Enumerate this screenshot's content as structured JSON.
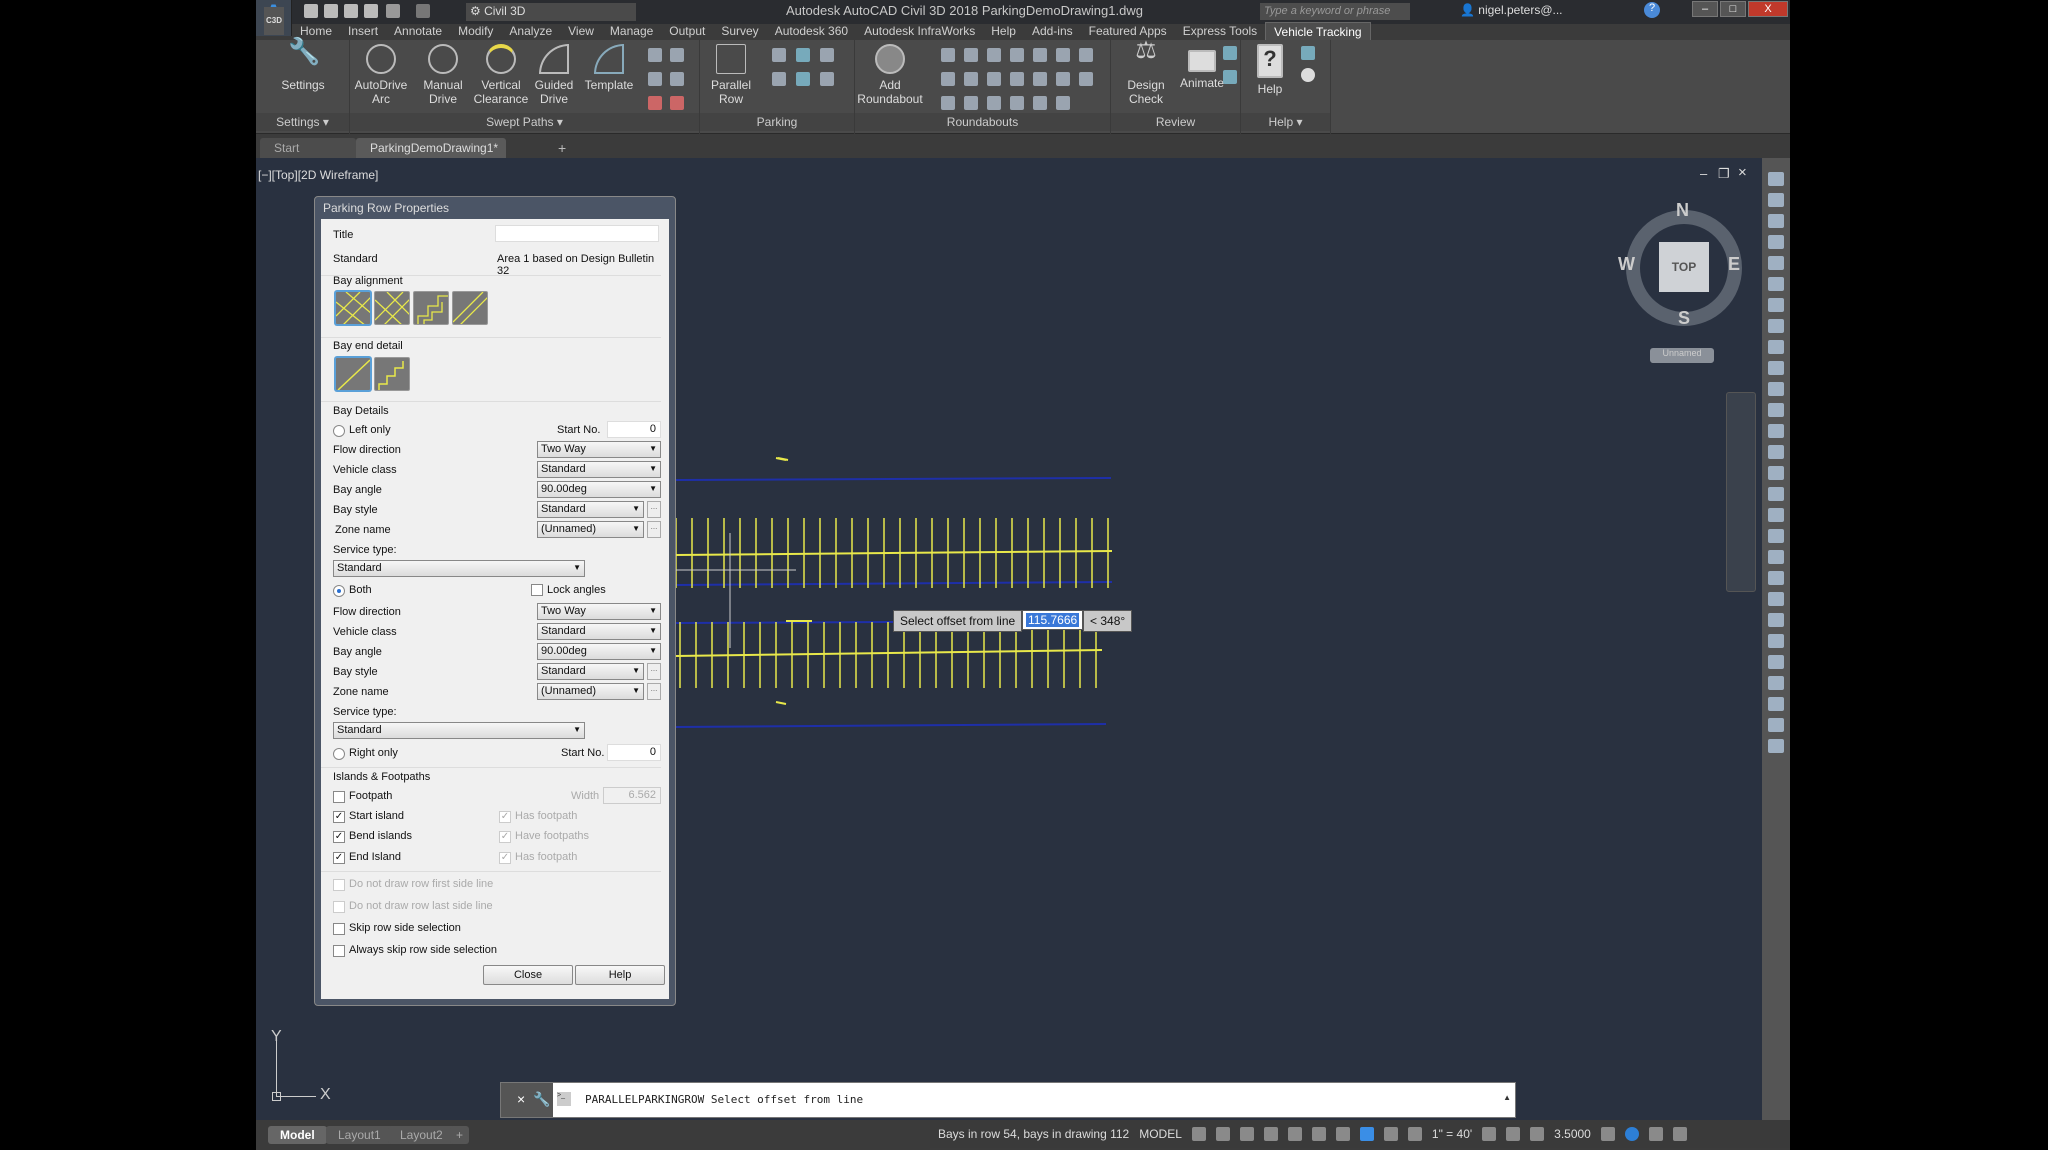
{
  "title_bar": {
    "app_button": "A",
    "app_badge": "C3D",
    "workspace": "Civil 3D",
    "title": "Autodesk AutoCAD Civil 3D 2018    ParkingDemoDrawing1.dwg",
    "search_placeholder": "Type a keyword or phrase",
    "user": "nigel.peters@...",
    "minimize": "–",
    "maximize": "□",
    "close": "X"
  },
  "menu_tabs": [
    "Home",
    "Insert",
    "Annotate",
    "Modify",
    "Analyze",
    "View",
    "Manage",
    "Output",
    "Survey",
    "Autodesk 360",
    "Autodesk InfraWorks",
    "Help",
    "Add-ins",
    "Featured Apps",
    "Express Tools",
    "Vehicle Tracking"
  ],
  "ribbon": {
    "panels": [
      "Settings ▾",
      "Swept Paths ▾",
      "Parking",
      "Roundabouts",
      "Review",
      "Help ▾"
    ],
    "buttons": {
      "settings": "Settings",
      "autodrive": "AutoDrive Arc",
      "manual": "Manual Drive",
      "vertical": "Vertical Clearance",
      "guided": "Guided Drive",
      "template": "Template",
      "parallel": "Parallel Row",
      "roundabout": "Add Roundabout",
      "design_check": "Design Check",
      "animate": "Animate",
      "help": "Help"
    }
  },
  "doc_tabs": {
    "start": "Start",
    "active": "ParkingDemoDrawing1*",
    "close": "×",
    "new": "+"
  },
  "viewport": {
    "label": "[−][Top][2D Wireframe]",
    "viewcube": {
      "n": "N",
      "s": "S",
      "e": "E",
      "w": "W",
      "face": "TOP",
      "ucs": "Unnamed"
    },
    "axis_x": "X",
    "axis_y": "Y",
    "controls": {
      "min": "–",
      "restore": "❐",
      "close": "×"
    }
  },
  "dialog": {
    "title": "Parking Row Properties",
    "title_label": "Title",
    "title_value": "",
    "standard_label": "Standard",
    "standard_value": "Area 1 based on Design Bulletin 32",
    "bay_alignment": "Bay alignment",
    "bay_end_detail": "Bay end detail",
    "bay_details": "Bay Details",
    "left_only": "Left only",
    "start_no_label": "Start No.",
    "left_start_no": "0",
    "left": {
      "flow_label": "Flow direction",
      "flow": "Two Way",
      "vehicle_label": "Vehicle class",
      "vehicle": "Standard",
      "angle_label": "Bay angle",
      "angle": "90.00deg",
      "style_label": "Bay style",
      "style": "Standard",
      "zone_label": "Zone name",
      "zone": "(Unnamed)",
      "service_label": "Service type:",
      "service": "Standard"
    },
    "both": "Both",
    "lock_angles": "Lock angles",
    "right": {
      "flow_label": "Flow direction",
      "flow": "Two Way",
      "vehicle_label": "Vehicle class",
      "vehicle": "Standard",
      "angle_label": "Bay angle",
      "angle": "90.00deg",
      "style_label": "Bay style",
      "style": "Standard",
      "zone_label": "Zone name",
      "zone": "(Unnamed)",
      "service_label": "Service type:",
      "service": "Standard"
    },
    "right_only": "Right only",
    "right_start_no": "0",
    "islands": "Islands & Footpaths",
    "footpath": "Footpath",
    "width_label": "Width",
    "width_value": "6.562",
    "start_island": "Start island",
    "bend_islands": "Bend islands",
    "end_island": "End Island",
    "has_footpath": "Has footpath",
    "have_footpaths": "Have footpaths",
    "has_footpath2": "Has footpath",
    "no_first": "Do not draw row first side line",
    "no_last": "Do not draw row last side line",
    "skip": "Skip row side selection",
    "always_skip": "Always skip row side selection",
    "ellipsis": "...",
    "check": "✓",
    "close": "Close",
    "help": "Help"
  },
  "tooltip": {
    "prompt": "Select offset from line",
    "value": "115.7666",
    "angle": "< 348°"
  },
  "command_line": {
    "text": "PARALLELPARKINGROW Select offset from line",
    "close": "×",
    "prompt_icon": ">_"
  },
  "layout_tabs": [
    "Model",
    "Layout1",
    "Layout2",
    "+"
  ],
  "status_bar": {
    "bays": "Bays in row 54, bays in drawing 112",
    "model": "MODEL",
    "scale": "1\" = 40'",
    "lineweight": "3.5000"
  },
  "colors": {
    "viewport": "#293140",
    "bay_line": "#e8e84a",
    "boundary": "#1e2fa8"
  }
}
